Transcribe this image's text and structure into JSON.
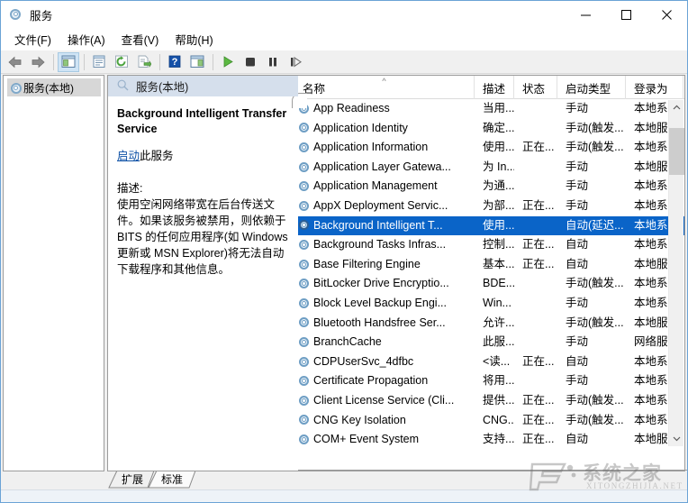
{
  "window": {
    "title": "服务",
    "icon": "services-gear-icon",
    "minimize_label": "最小化",
    "maximize_label": "最大化",
    "close_label": "关闭"
  },
  "menu": {
    "items": [
      {
        "label": "文件(F)",
        "name": "menu-file"
      },
      {
        "label": "操作(A)",
        "name": "menu-action"
      },
      {
        "label": "查看(V)",
        "name": "menu-view"
      },
      {
        "label": "帮助(H)",
        "name": "menu-help"
      }
    ]
  },
  "toolbar": {
    "buttons": [
      {
        "name": "back-icon",
        "glyph": "back"
      },
      {
        "name": "forward-icon",
        "glyph": "forward"
      },
      {
        "name": "show-hide-console-tree-icon",
        "glyph": "tree"
      },
      {
        "name": "properties-icon",
        "glyph": "properties"
      },
      {
        "name": "refresh-icon",
        "glyph": "refresh"
      },
      {
        "name": "export-list-icon",
        "glyph": "export"
      },
      {
        "name": "help-icon",
        "glyph": "help"
      },
      {
        "name": "show-hide-action-pane-icon",
        "glyph": "pane"
      },
      {
        "name": "start-service-icon",
        "glyph": "play"
      },
      {
        "name": "stop-service-icon",
        "glyph": "stop"
      },
      {
        "name": "pause-service-icon",
        "glyph": "pause"
      },
      {
        "name": "restart-service-icon",
        "glyph": "restart"
      }
    ]
  },
  "tree": {
    "items": [
      {
        "label": "服务(本地)",
        "name": "tree-item-services-local",
        "selected": true
      }
    ]
  },
  "detail": {
    "header": "服务(本地)",
    "service_name": "Background Intelligent Transfer Service",
    "action_link": "启动",
    "action_suffix": "此服务",
    "description_label": "描述:",
    "description": "使用空闲网络带宽在后台传送文件。如果该服务被禁用，则依赖于 BITS 的任何应用程序(如 Windows 更新或 MSN Explorer)将无法自动下载程序和其他信息。"
  },
  "list": {
    "columns": [
      {
        "label": "名称",
        "name": "column-header-name",
        "sorted": true,
        "sort_glyph": "^"
      },
      {
        "label": "描述",
        "name": "column-header-description"
      },
      {
        "label": "状态",
        "name": "column-header-status"
      },
      {
        "label": "启动类型",
        "name": "column-header-startup-type"
      },
      {
        "label": "登录为",
        "name": "column-header-log-on-as"
      }
    ],
    "rows": [
      {
        "name": "App Readiness",
        "desc": "当用...",
        "status": "",
        "startup": "手动",
        "logon": "本地系统",
        "selected": false
      },
      {
        "name": "Application Identity",
        "desc": "确定...",
        "status": "",
        "startup": "手动(触发...",
        "logon": "本地服务",
        "selected": false
      },
      {
        "name": "Application Information",
        "desc": "使用...",
        "status": "正在...",
        "startup": "手动(触发...",
        "logon": "本地系统",
        "selected": false
      },
      {
        "name": "Application Layer Gatewa...",
        "desc": "为 In...",
        "status": "",
        "startup": "手动",
        "logon": "本地服务",
        "selected": false
      },
      {
        "name": "Application Management",
        "desc": "为通...",
        "status": "",
        "startup": "手动",
        "logon": "本地系统",
        "selected": false
      },
      {
        "name": "AppX Deployment Servic...",
        "desc": "为部...",
        "status": "正在...",
        "startup": "手动",
        "logon": "本地系统",
        "selected": false
      },
      {
        "name": "Background Intelligent T...",
        "desc": "使用...",
        "status": "",
        "startup": "自动(延迟...",
        "logon": "本地系统",
        "selected": true
      },
      {
        "name": "Background Tasks Infras...",
        "desc": "控制...",
        "status": "正在...",
        "startup": "自动",
        "logon": "本地系统",
        "selected": false
      },
      {
        "name": "Base Filtering Engine",
        "desc": "基本...",
        "status": "正在...",
        "startup": "自动",
        "logon": "本地服务",
        "selected": false
      },
      {
        "name": "BitLocker Drive Encryptio...",
        "desc": "BDE...",
        "status": "",
        "startup": "手动(触发...",
        "logon": "本地系统",
        "selected": false
      },
      {
        "name": "Block Level Backup Engi...",
        "desc": "Win...",
        "status": "",
        "startup": "手动",
        "logon": "本地系统",
        "selected": false
      },
      {
        "name": "Bluetooth Handsfree Ser...",
        "desc": "允许...",
        "status": "",
        "startup": "手动(触发...",
        "logon": "本地服务",
        "selected": false
      },
      {
        "name": "BranchCache",
        "desc": "此服...",
        "status": "",
        "startup": "手动",
        "logon": "网络服务",
        "selected": false
      },
      {
        "name": "CDPUserSvc_4dfbc",
        "desc": "<读...",
        "status": "正在...",
        "startup": "自动",
        "logon": "本地系统",
        "selected": false
      },
      {
        "name": "Certificate Propagation",
        "desc": "将用...",
        "status": "",
        "startup": "手动",
        "logon": "本地系统",
        "selected": false
      },
      {
        "name": "Client License Service (Cli...",
        "desc": "提供...",
        "status": "正在...",
        "startup": "手动(触发...",
        "logon": "本地系统",
        "selected": false
      },
      {
        "name": "CNG Key Isolation",
        "desc": "CNG...",
        "status": "正在...",
        "startup": "手动(触发...",
        "logon": "本地系统",
        "selected": false
      },
      {
        "name": "COM+ Event System",
        "desc": "支持...",
        "status": "正在...",
        "startup": "自动",
        "logon": "本地服务",
        "selected": false
      }
    ]
  },
  "tabs": [
    {
      "label": "扩展",
      "name": "tab-extended",
      "active": false
    },
    {
      "label": "标准",
      "name": "tab-standard",
      "active": true
    }
  ],
  "scrollbar": {
    "up_glyph": "^",
    "down_glyph": "v"
  },
  "watermark": {
    "text": "系统之家",
    "subtext": "XITONGZHIJIA.NET"
  },
  "colors": {
    "selection": "#0a64c8",
    "detail_header": "#d5dfec",
    "window_border": "#6ba3d6",
    "link": "#0b4fa5"
  }
}
